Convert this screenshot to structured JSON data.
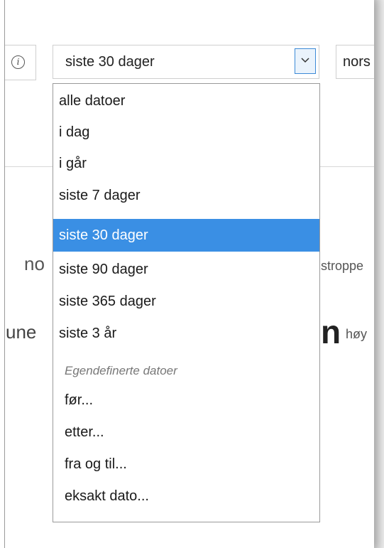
{
  "header": {
    "info_icon_glyph": "i",
    "date_select": {
      "value": "siste 30 dager"
    },
    "language_select": {
      "value": "nors"
    }
  },
  "background": {
    "text_no": "no",
    "text_stroppe": "stroppe",
    "text_une": "une",
    "text_big": "n",
    "text_hoy": "høy"
  },
  "dropdown": {
    "options": [
      {
        "label": "alle datoer"
      },
      {
        "label": "i dag"
      },
      {
        "label": "i går"
      },
      {
        "label": "siste 7 dager"
      },
      {
        "label": "siste 30 dager",
        "selected": true
      },
      {
        "label": "siste 90 dager"
      },
      {
        "label": "siste 365 dager"
      },
      {
        "label": "siste 3 år"
      }
    ],
    "group_label": "Egendefinerte datoer",
    "custom_options": [
      {
        "label": "før..."
      },
      {
        "label": "etter..."
      },
      {
        "label": "fra og til..."
      },
      {
        "label": "eksakt dato..."
      }
    ]
  },
  "colors": {
    "selected_bg": "#3a8fe4",
    "arrow_border": "#3c8ad6"
  },
  "icons": [
    "info-icon",
    "chevron-down-icon"
  ]
}
